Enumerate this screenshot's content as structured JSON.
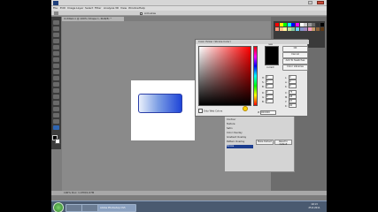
{
  "app": {
    "title": "",
    "menu": [
      "File",
      "Edit",
      "Image",
      "Layer",
      "Select",
      "Filter",
      "Analysis",
      "3D",
      "View",
      "Window",
      "Help"
    ],
    "document_tab": "Untitled-1 @ 100% (Shape 1, RGB/8) *",
    "status": "100%   Doc: 1.07M/1.07M",
    "options_text": "Anti-alias"
  },
  "color_picker": {
    "title": "Color Picker (Stroke Color)",
    "buttons": {
      "ok": "OK",
      "cancel": "Cancel",
      "add_swatches": "Add To Swatches",
      "libraries": "Color Libraries"
    },
    "new_label": "new",
    "current_label": "current",
    "only_web_colors": "Only Web Colors",
    "hsb": [
      {
        "label": "H:",
        "value": "0"
      },
      {
        "label": "S:",
        "value": "0"
      },
      {
        "label": "B:",
        "value": "0"
      }
    ],
    "rgb": [
      {
        "label": "R:",
        "value": "0"
      },
      {
        "label": "G:",
        "value": "0"
      },
      {
        "label": "B:",
        "value": "0"
      }
    ],
    "lab": [
      {
        "label": "L:",
        "value": "0"
      },
      {
        "label": "a:",
        "value": "0"
      },
      {
        "label": "b:",
        "value": "0"
      }
    ],
    "cmyk": [
      {
        "label": "C:",
        "value": "75"
      },
      {
        "label": "M:",
        "value": "68"
      },
      {
        "label": "Y:",
        "value": "67"
      },
      {
        "label": "K:",
        "value": "90"
      }
    ],
    "hex_label": "#",
    "hex_value": "000000",
    "colors": {
      "new": "#000000",
      "current": "#000000"
    }
  },
  "layer_style": {
    "items": [
      "Contour",
      "Texture",
      "Satin",
      "Color Overlay",
      "Gradient Overlay",
      "Pattern Overlay",
      "Stroke"
    ],
    "selected": "Stroke",
    "buttons": {
      "make_default": "Make Default",
      "reset_default": "Reset to Default"
    }
  },
  "taskbar": {
    "buttons": [
      "Adobe Photoshop CS5"
    ],
    "time": "19:13",
    "date": "25.6.2011"
  },
  "swatch_colors": [
    "#ff0000",
    "#ffff00",
    "#00ff00",
    "#00ffff",
    "#0000ff",
    "#ff00ff",
    "#ffffff",
    "#cccccc",
    "#999999",
    "#666666",
    "#333333",
    "#000000",
    "#f7977a",
    "#fdc68a",
    "#fff79a",
    "#c4df9b",
    "#82ca9d",
    "#6dcff6",
    "#8493ca",
    "#a187be",
    "#f49ac2",
    "#c69c6d",
    "#8c6239",
    "#603913"
  ]
}
